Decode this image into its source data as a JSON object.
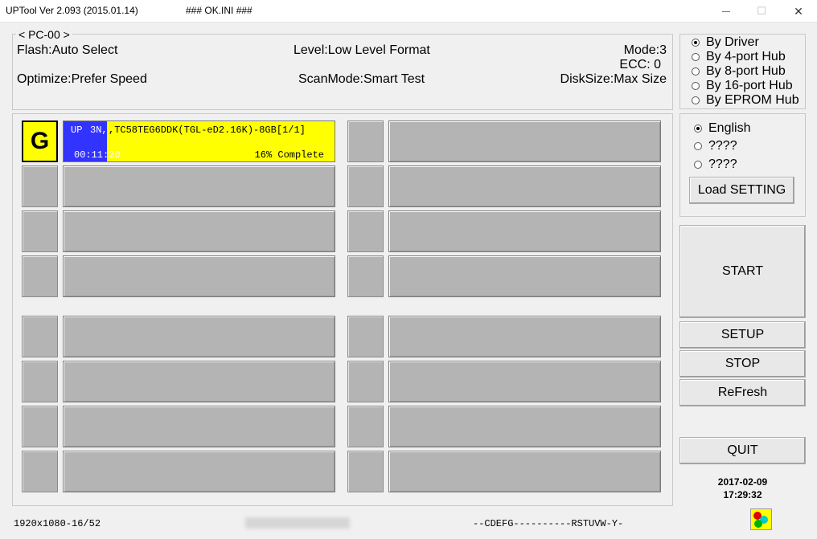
{
  "window": {
    "title": "UPTool Ver 2.093 (2015.01.14)",
    "ini": "### OK.INI ###",
    "min_glyph": "—",
    "max_glyph": "☐",
    "close_glyph": "✕"
  },
  "info": {
    "group_label": "< PC-00 >",
    "flash": "Flash:Auto Select",
    "level": "Level:Low Level Format",
    "mode": "Mode:3",
    "ecc": "ECC: 0",
    "optimize": "Optimize:Prefer Speed",
    "scanmode": "ScanMode:Smart Test",
    "disksize": "DiskSize:Max Size"
  },
  "hub_options": [
    {
      "label": "By Driver",
      "selected": true
    },
    {
      "label": "By 4-port Hub",
      "selected": false
    },
    {
      "label": "By 8-port Hub",
      "selected": false
    },
    {
      "label": "By 16-port Hub",
      "selected": false
    },
    {
      "label": "By EPROM Hub",
      "selected": false
    }
  ],
  "language_options": [
    {
      "label": "English",
      "selected": true
    },
    {
      "label": "????",
      "selected": false
    },
    {
      "label": "????",
      "selected": false
    }
  ],
  "buttons": {
    "load_setting": "Load SETTING",
    "start": "START",
    "setup": "SETUP",
    "stop": "STOP",
    "refresh": "ReFresh",
    "quit": "QUIT"
  },
  "active_slot": {
    "letter": "G",
    "line1_prefix": "UP",
    "line1_mid": "3N,",
    "line1_rest": ",TC58TEG6DDK(TGL-eD2.16K)-8GB[1/1]",
    "time": "00:11:20",
    "status": "16% Complete",
    "progress_percent": 16,
    "colors": {
      "bar": "#ffff00",
      "progress": "#3333ff"
    }
  },
  "footer": {
    "resolution": "1920x1080-16/52",
    "drives": "--CDEFG----------RSTUVW-Y-",
    "date": "2017-02-09",
    "time": "17:29:32"
  }
}
